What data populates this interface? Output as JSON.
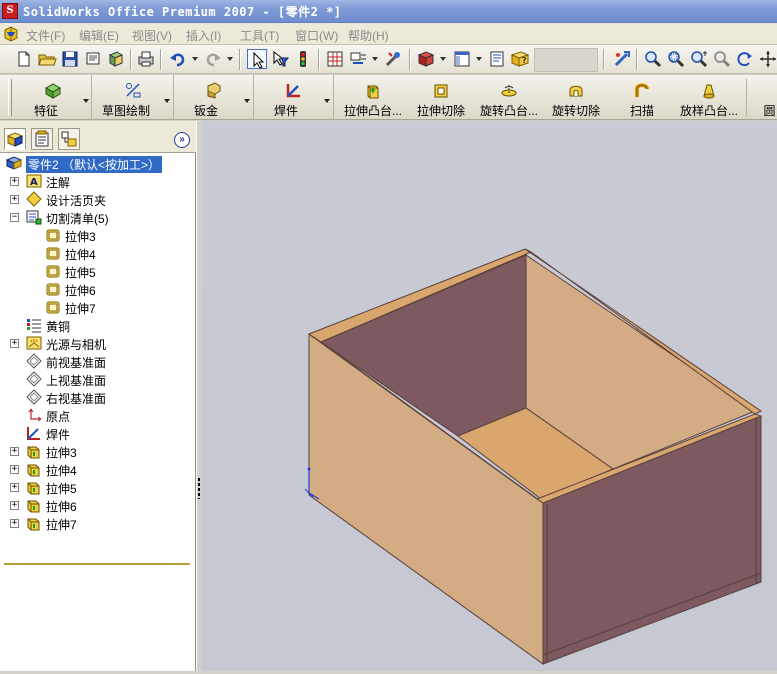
{
  "window": {
    "title": "SolidWorks Office Premium 2007 - [零件2 *]",
    "app_icon_letter": "S"
  },
  "menu": {
    "items": [
      {
        "label": "文件(F)"
      },
      {
        "label": "编辑(E)"
      },
      {
        "label": "视图(V)"
      },
      {
        "label": "插入(I)"
      },
      {
        "label": "工具(T)"
      },
      {
        "label": "窗口(W)"
      },
      {
        "label": "帮助(H)"
      }
    ]
  },
  "command_manager": {
    "tabs": [
      {
        "label": "特征",
        "icon": "feature-icon"
      },
      {
        "label": "草图绘制",
        "icon": "sketch-icon"
      },
      {
        "label": "钣金",
        "icon": "sheetmetal-icon"
      },
      {
        "label": "焊件",
        "icon": "weldment-icon"
      }
    ],
    "commands": [
      {
        "label": "拉伸凸台...",
        "icon": "extruded-boss-icon"
      },
      {
        "label": "拉伸切除",
        "icon": "extruded-cut-icon"
      },
      {
        "label": "旋转凸台...",
        "icon": "revolved-boss-icon"
      },
      {
        "label": "旋转切除",
        "icon": "revolved-cut-icon"
      },
      {
        "label": "扫描",
        "icon": "sweep-icon"
      },
      {
        "label": "放样凸台...",
        "icon": "loft-icon"
      },
      {
        "label": "圆",
        "icon": "circle-icon"
      }
    ]
  },
  "feature_tree": {
    "root": {
      "label": "零件2 （默认<按加工>）"
    },
    "items": [
      {
        "label": "注解",
        "icon": "annotations-icon"
      },
      {
        "label": "设计活页夹",
        "icon": "design-binder-icon"
      },
      {
        "label": "切割清单(5)",
        "icon": "cut-list-icon"
      },
      {
        "label": "拉伸3",
        "icon": "cut-list-body-icon"
      },
      {
        "label": "拉伸4",
        "icon": "cut-list-body-icon"
      },
      {
        "label": "拉伸5",
        "icon": "cut-list-body-icon"
      },
      {
        "label": "拉伸6",
        "icon": "cut-list-body-icon"
      },
      {
        "label": "拉伸7",
        "icon": "cut-list-body-icon"
      },
      {
        "label": "黄铜",
        "icon": "material-icon"
      },
      {
        "label": "光源与相机",
        "icon": "lights-cameras-icon"
      },
      {
        "label": "前视基准面",
        "icon": "plane-icon"
      },
      {
        "label": "上视基准面",
        "icon": "plane-icon"
      },
      {
        "label": "右视基准面",
        "icon": "plane-icon"
      },
      {
        "label": "原点",
        "icon": "origin-icon"
      },
      {
        "label": "焊件",
        "icon": "weldment-feature-icon"
      },
      {
        "label": "拉伸3",
        "icon": "extrude-feature-icon"
      },
      {
        "label": "拉伸4",
        "icon": "extrude-feature-icon"
      },
      {
        "label": "拉伸5",
        "icon": "extrude-feature-icon"
      },
      {
        "label": "拉伸6",
        "icon": "extrude-feature-icon"
      },
      {
        "label": "拉伸7",
        "icon": "extrude-feature-icon"
      }
    ]
  },
  "colors": {
    "box_face_light": "#d4ac84",
    "box_face_dark": "#7c5a60",
    "box_floor": "#d9a76e",
    "box_edge": "#5a3f3a",
    "viewport_bg": "#c6c8d2",
    "selection": "#316ac5"
  }
}
